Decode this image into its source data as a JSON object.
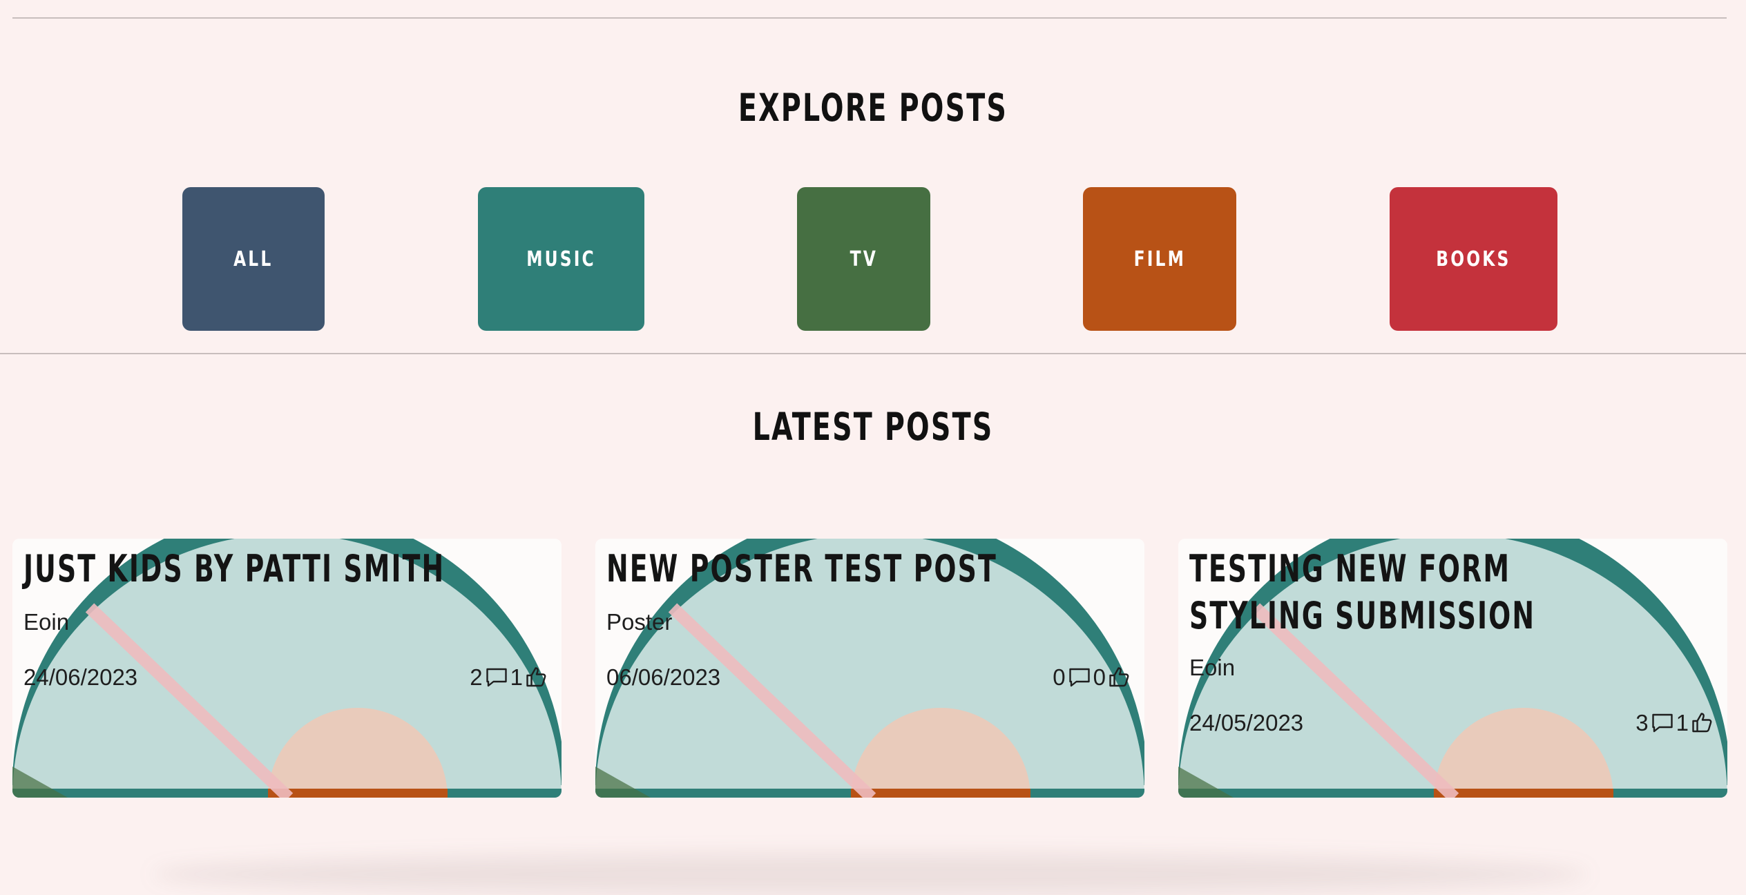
{
  "explore": {
    "title": "EXPLORE POSTS",
    "categories": [
      {
        "label": "ALL",
        "color": "#3f556f"
      },
      {
        "label": "MUSIC",
        "color": "#2f7f78"
      },
      {
        "label": "TV",
        "color": "#466f42"
      },
      {
        "label": "FILM",
        "color": "#b85216"
      },
      {
        "label": "BOOKS",
        "color": "#c4323c"
      }
    ]
  },
  "latest": {
    "title": "LATEST POSTS",
    "posts": [
      {
        "title": "JUST KIDS BY PATTI SMITH",
        "author": "Eoin",
        "date": "24/06/2023",
        "comments": "2",
        "likes": "1"
      },
      {
        "title": "NEW POSTER TEST POST",
        "author": "Poster",
        "date": "06/06/2023",
        "comments": "0",
        "likes": "0"
      },
      {
        "title": "TESTING NEW FORM STYLING SUBMISSION",
        "author": "Eoin",
        "date": "24/05/2023",
        "comments": "3",
        "likes": "1"
      }
    ]
  },
  "icons": {
    "comment": "comment-icon",
    "like": "thumbs-up-icon"
  },
  "colors": {
    "background": "#fcf1f0",
    "card_semicircle": "#c1dbd8",
    "card_arc": "#2f7f78",
    "card_stripe": "#efbcbf",
    "card_sun": "#e9cbbb",
    "card_base_orange": "#b85216"
  }
}
